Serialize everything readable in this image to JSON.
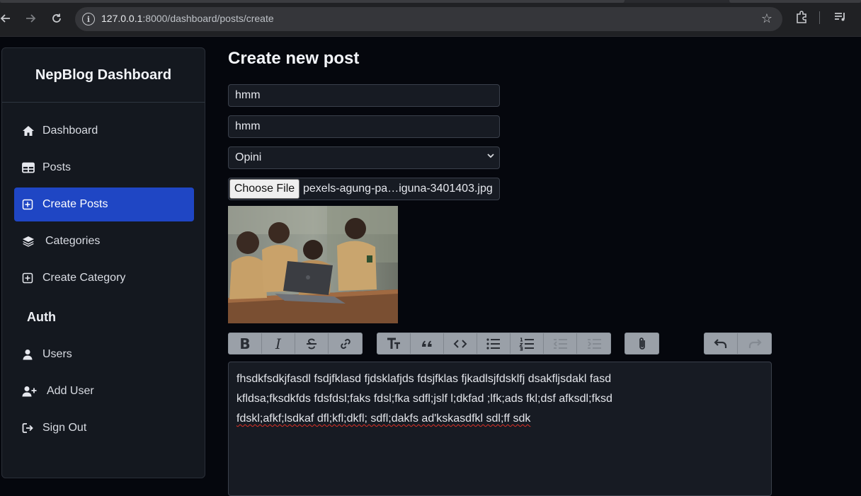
{
  "browser": {
    "url_host": "127.0.0.1",
    "url_rest": ":8000/dashboard/posts/create"
  },
  "sidebar": {
    "brand": "NepBlog Dashboard",
    "items": [
      {
        "label": "Dashboard",
        "icon": "home-icon"
      },
      {
        "label": "Posts",
        "icon": "table-icon"
      },
      {
        "label": "Create Posts",
        "icon": "plus-square-icon",
        "active": true
      },
      {
        "label": "Categories",
        "icon": "layers-icon"
      },
      {
        "label": "Create Category",
        "icon": "plus-square-icon"
      }
    ],
    "auth_label": "Auth",
    "auth_items": [
      {
        "label": "Users",
        "icon": "user-icon"
      },
      {
        "label": "Add User",
        "icon": "user-plus-icon"
      },
      {
        "label": "Sign Out",
        "icon": "sign-out-icon"
      }
    ]
  },
  "form": {
    "title": "Create new post",
    "title_value": "hmm",
    "slug_value": "hmm",
    "category_selected": "Opini",
    "choose_file_label": "Choose File",
    "file_name": "pexels-agung-pa…iguna-3401403.jpg",
    "body_lines": [
      "fhsdkfsdkjfasdl fsdjfklasd fjdsklafjds fdsjfklas fjkadlsjfdsklfj dsakfljsdakl fasd",
      "kfldsa;fksdkfds fdsfdsl;faks fdsl;fka sdfl;jslf l;dkfad ;lfk;ads fkl;dsf afksdl;fksd",
      "fdskl;afkf;lsdkaf dfl;kfl;dkfl; sdfl;dakfs ad'kskasdfkl sdl;ff sdk"
    ]
  },
  "colors": {
    "accent": "#1f46c4",
    "background": "#05070d",
    "sidebar": "#14181f"
  }
}
